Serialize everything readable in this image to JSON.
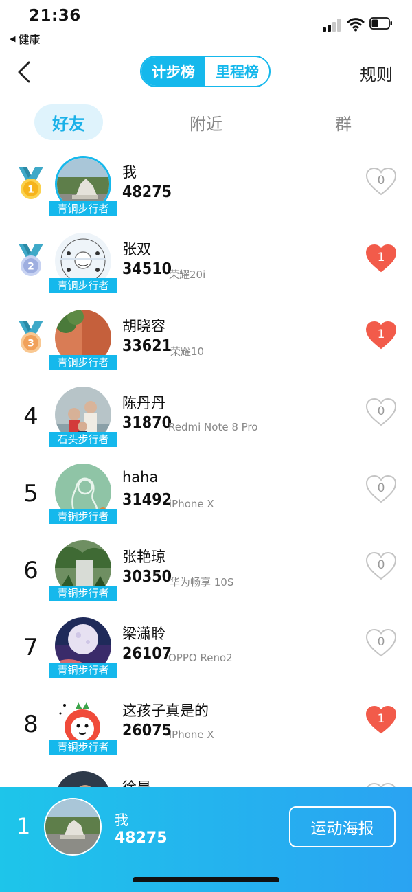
{
  "status_bar": {
    "time": "21:36",
    "back_app": "健康"
  },
  "nav": {
    "tab_steps": "计步榜",
    "tab_distance": "里程榜",
    "rules": "规则"
  },
  "tabs": [
    "好友",
    "附近",
    "群"
  ],
  "colors": {
    "accent": "#15b8ec",
    "like_active": "#f25b4a",
    "like_inactive": "#c4c4c4"
  },
  "rows": [
    {
      "rank": "1",
      "name": "我",
      "steps": "48275",
      "device": "",
      "badge": "青铜步行者",
      "likes": "0",
      "liked": false
    },
    {
      "rank": "2",
      "name": "张双",
      "steps": "34510",
      "device": "荣耀20i",
      "badge": "青铜步行者",
      "likes": "1",
      "liked": true
    },
    {
      "rank": "3",
      "name": "胡晓容",
      "steps": "33621",
      "device": "荣耀10",
      "badge": "青铜步行者",
      "likes": "1",
      "liked": true
    },
    {
      "rank": "4",
      "name": "陈丹丹",
      "steps": "31870",
      "device": "Redmi Note 8 Pro",
      "badge": "石头步行者",
      "likes": "0",
      "liked": false
    },
    {
      "rank": "5",
      "name": "haha",
      "steps": "31492",
      "device": "iPhone X",
      "badge": "青铜步行者",
      "likes": "0",
      "liked": false
    },
    {
      "rank": "6",
      "name": "张艳琼",
      "steps": "30350",
      "device": "华为畅享 10S",
      "badge": "青铜步行者",
      "likes": "0",
      "liked": false
    },
    {
      "rank": "7",
      "name": "梁潇聆",
      "steps": "26107",
      "device": "OPPO Reno2",
      "badge": "青铜步行者",
      "likes": "0",
      "liked": false
    },
    {
      "rank": "8",
      "name": "这孩子真是的",
      "steps": "26075",
      "device": "iPhone X",
      "badge": "青铜步行者",
      "likes": "1",
      "liked": true
    },
    {
      "rank": "",
      "name": "徐昊",
      "steps": "",
      "device": "",
      "badge": "",
      "likes": "",
      "liked": false
    }
  ],
  "footer": {
    "rank": "1",
    "name": "我",
    "steps": "48275",
    "poster_button": "运动海报"
  }
}
